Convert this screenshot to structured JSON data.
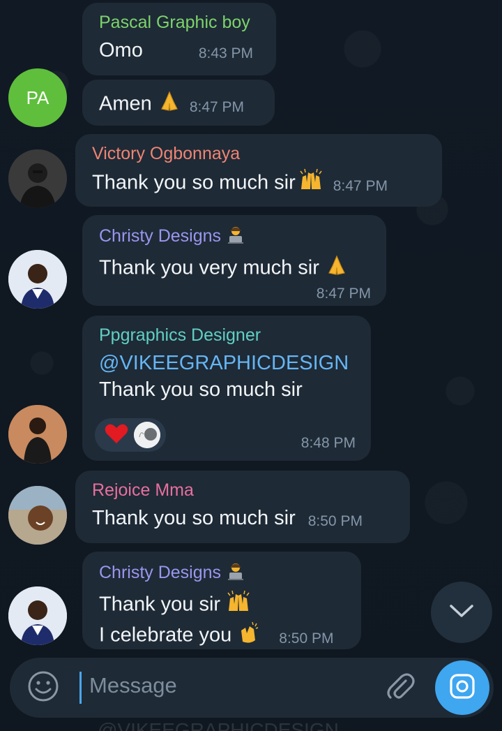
{
  "colors": {
    "background": "#0e1621",
    "bubble": "#1e2a36",
    "accent": "#3fa6f0",
    "mention": "#66b6f4",
    "name_pascal": "#7dd36b",
    "name_victory": "#ef8473",
    "name_christy": "#9a96ee",
    "name_ppgraphics": "#61cfc3",
    "name_rejoice": "#e86f9e"
  },
  "messages": [
    {
      "sender": "Pascal Graphic boy",
      "text": "Omo",
      "time": "8:43 PM"
    },
    {
      "text": "Amen",
      "emoji": "folded-hands",
      "time": "8:47 PM",
      "avatar_initials": "PA"
    },
    {
      "sender": "Victory Ogbonnaya",
      "text": "Thank you so much sir",
      "emoji": "raising-hands",
      "time": "8:47 PM"
    },
    {
      "sender": "Christy Designs",
      "sender_emoji": "technologist",
      "text": "Thank you very much sir",
      "emoji": "folded-hands",
      "time": "8:47 PM"
    },
    {
      "sender": "Ppgraphics Designer",
      "mention": "@VIKEEGRAPHICDESIGN",
      "text": "Thank you so much sir",
      "reaction": "heart",
      "time": "8:48 PM"
    },
    {
      "sender": "Rejoice Mma",
      "text": "Thank you so much sir",
      "time": "8:50 PM"
    },
    {
      "sender": "Christy Designs",
      "sender_emoji": "technologist",
      "text_line1": "Thank you sir",
      "text_line1_emoji": "raising-hands",
      "text_line2": "I celebrate you",
      "text_line2_emoji": "clapping-hands",
      "time": "8:50 PM"
    }
  ],
  "composer": {
    "placeholder": "Message",
    "icons": [
      "smiley-icon",
      "paperclip-icon",
      "camera-icon"
    ]
  },
  "partial_bottom_text": "@VIKEEGRAPHICDESIGN"
}
